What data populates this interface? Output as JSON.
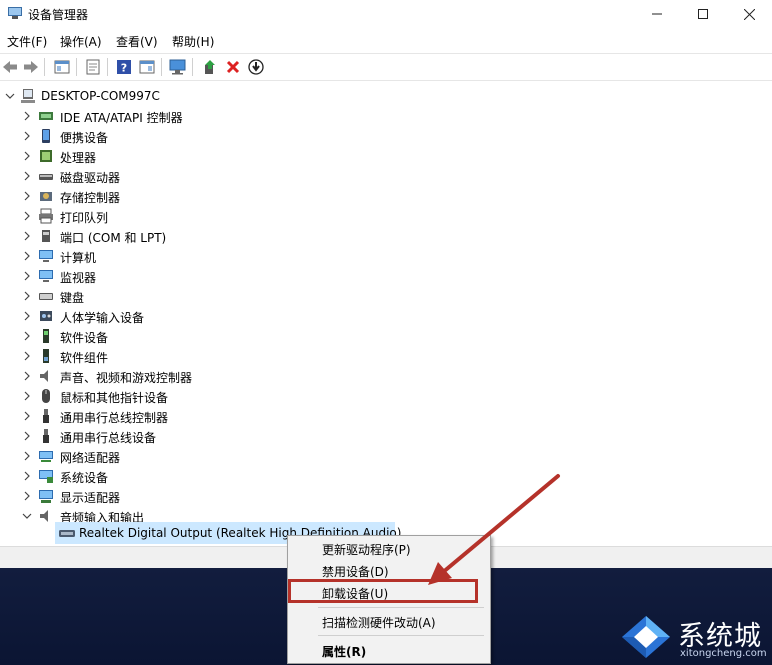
{
  "window": {
    "title": "设备管理器"
  },
  "menu": [
    "文件(F)",
    "操作(A)",
    "查看(V)",
    "帮助(H)"
  ],
  "tree": {
    "root": "DESKTOP-COM997C",
    "categories": [
      {
        "label": "IDE ATA/ATAPI 控制器",
        "icon": "ide-controller-icon"
      },
      {
        "label": "便携设备",
        "icon": "portable-device-icon"
      },
      {
        "label": "处理器",
        "icon": "processor-icon"
      },
      {
        "label": "磁盘驱动器",
        "icon": "disk-drive-icon"
      },
      {
        "label": "存储控制器",
        "icon": "storage-controller-icon"
      },
      {
        "label": "打印队列",
        "icon": "printer-icon"
      },
      {
        "label": "端口 (COM 和 LPT)",
        "icon": "port-icon"
      },
      {
        "label": "计算机",
        "icon": "computer-icon"
      },
      {
        "label": "监视器",
        "icon": "monitor-icon"
      },
      {
        "label": "键盘",
        "icon": "keyboard-icon"
      },
      {
        "label": "人体学输入设备",
        "icon": "hid-icon"
      },
      {
        "label": "软件设备",
        "icon": "software-device-icon"
      },
      {
        "label": "软件组件",
        "icon": "software-component-icon"
      },
      {
        "label": "声音、视频和游戏控制器",
        "icon": "sound-icon"
      },
      {
        "label": "鼠标和其他指针设备",
        "icon": "mouse-icon"
      },
      {
        "label": "通用串行总线控制器",
        "icon": "usb-icon"
      },
      {
        "label": "通用串行总线设备",
        "icon": "usb-icon"
      },
      {
        "label": "网络适配器",
        "icon": "network-adapter-icon"
      },
      {
        "label": "系统设备",
        "icon": "system-device-icon"
      },
      {
        "label": "显示适配器",
        "icon": "display-adapter-icon"
      },
      {
        "label": "音频输入和输出",
        "icon": "audio-io-icon"
      }
    ],
    "selected_child": "Realtek Digital Output (Realtek High Definition Audio)"
  },
  "context_menu": {
    "update_driver": "更新驱动程序(P)",
    "disable_device": "禁用设备(D)",
    "uninstall_device": "卸载设备(U)",
    "scan_hardware": "扫描检测硬件改动(A)",
    "properties": "属性(R)"
  },
  "watermark": {
    "text": "系统城",
    "url": "xitongcheng.com"
  },
  "colors": {
    "highlight_box": "#b5322a",
    "selection": "#cce8ff",
    "arrow": "#b5322a"
  }
}
